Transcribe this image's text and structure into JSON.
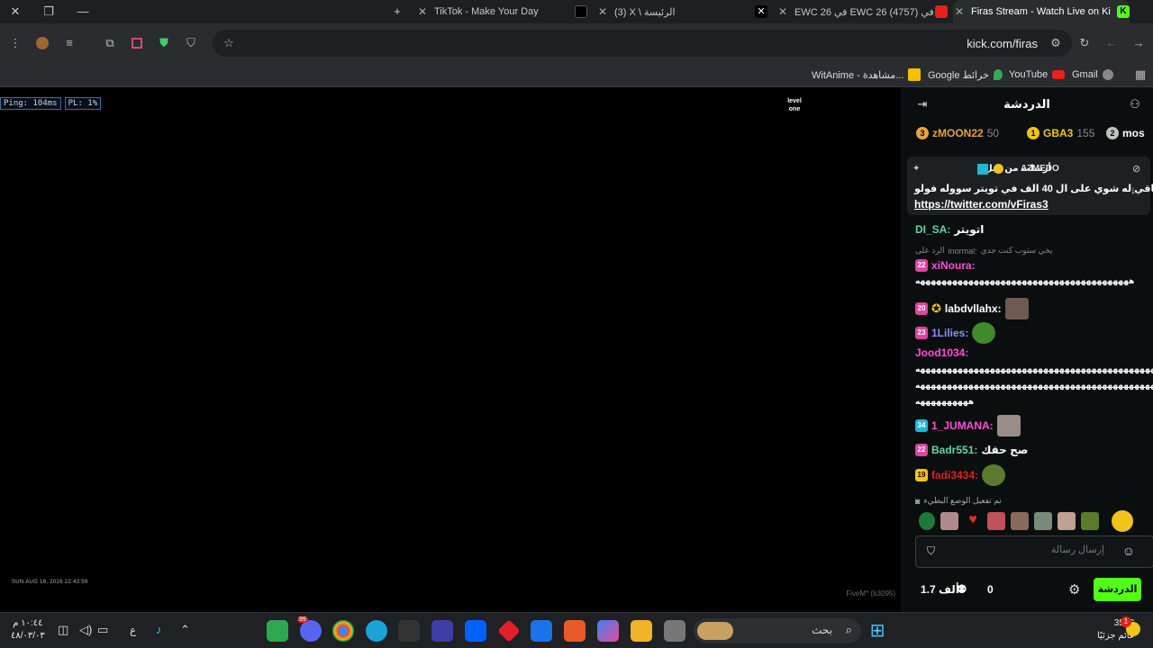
{
  "tabs": [
    {
      "title": "TikTok - Make Your Day",
      "active": false
    },
    {
      "title": "(3) X \\ الرئيسة",
      "active": false
    },
    {
      "title": "EWC 26 في EWC 26 (4757) روكيت ليق في",
      "active": false
    },
    {
      "title": "Firas Stream - Watch Live on Ki",
      "active": true
    }
  ],
  "toolbar": {
    "url": "kick.com/firas"
  },
  "bookmarks": [
    {
      "label": "Gmail"
    },
    {
      "label": "YouTube"
    },
    {
      "label": "Google خرائط"
    },
    {
      "label": "WitAnime - مشاهدة..."
    }
  ],
  "video": {
    "hud_ping": "Ping: 104ms",
    "hud_pl": "PL: 1%",
    "timestamp": "SUN AUG 16, 2026 22:43:59",
    "fivem": "FiveM* (b3095)",
    "logo_text": "level one"
  },
  "chat": {
    "title": "الدردشة",
    "leaderboard": [
      {
        "rank": "3",
        "name": "zMOON22",
        "points": "50",
        "color": "#e8a33c"
      },
      {
        "rank": "1",
        "name": "GBA3",
        "points": "155",
        "color": "#f0c419"
      },
      {
        "rank": "2",
        "name": "mos",
        "points": "",
        "color": "#c0c0c0"
      }
    ],
    "pinned": {
      "header": "أرسلت من قبل",
      "user": "A7MEDO",
      "text": "وباقي له شوي على ال 40 الف في تويتر سووله فولو",
      "link": "https://twitter.com/vFiras3"
    },
    "messages": [
      {
        "user": "DI_SA:",
        "text": "اتويتر",
        "color": "#5fd7a0",
        "badge": "",
        "badge_color": ""
      },
      {
        "user": "inormal:",
        "text": "الرد على",
        "extra": "يخي ستوب كنت جدي",
        "color": "#999",
        "badge": "",
        "badge_color": ""
      },
      {
        "user": "xiNoura:",
        "text": "",
        "color": "#ff4fd8",
        "badge": "22",
        "badge_color": "#e0439f"
      },
      {
        "user": "",
        "text": "ههههههههههههههههههههههههههههههههههههههههه",
        "color": "#fff",
        "badge": "",
        "badge_color": ""
      },
      {
        "user": "labdvllahx:",
        "text": "",
        "color": "#fff",
        "badge": "20",
        "badge_color": "#e0439f"
      },
      {
        "user": "1Lilies:",
        "text": "",
        "color": "#8c8cff",
        "badge": "23",
        "badge_color": "#e0439f"
      },
      {
        "user": "Jood1034:",
        "text": "",
        "color": "#ff4fd8",
        "badge": "",
        "badge_color": ""
      },
      {
        "user": "",
        "text": "ههههههههههههههههههههههههههههههههههههههههههههههههههه",
        "color": "#fff",
        "badge": "",
        "badge_color": ""
      },
      {
        "user": "",
        "text": "هههههههههههههههههههههههههههههههههههههههههههههههههههه",
        "color": "#fff",
        "badge": "",
        "badge_color": ""
      },
      {
        "user": "",
        "text": "ههههههههههه",
        "color": "#fff",
        "badge": "",
        "badge_color": ""
      },
      {
        "user": "1_JUMANA:",
        "text": "",
        "color": "#ff4fd8",
        "badge": "34",
        "badge_color": "#1fb6d6"
      },
      {
        "user": "Badr551:",
        "text": "صح حقك",
        "color": "#5fd7a0",
        "badge": "22",
        "badge_color": "#e0439f"
      },
      {
        "user": "fadi3434:",
        "text": "",
        "color": "#e02020",
        "badge": "19",
        "badge_color": "#f0c419"
      }
    ],
    "slow_mode": "تم تفعيل الوضع البطيء",
    "input_placeholder": "إرسال رسالة",
    "viewers": "0",
    "followers": "1.7 ألف",
    "send_label": "الدردشة"
  },
  "taskbar": {
    "search_placeholder": "بحث",
    "weather_temp": "35°C",
    "weather_desc": "غائم جزئيًا",
    "time": "١٠:٤٤ م",
    "date": "٤٨/٠٣/٠٣",
    "lang": "ع",
    "notification_count": "1",
    "discord_count": "99"
  }
}
